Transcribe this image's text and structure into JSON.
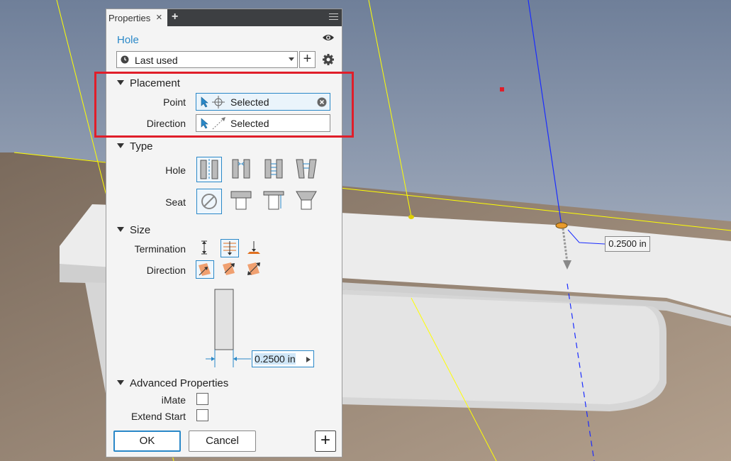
{
  "panel": {
    "tab_label": "Properties",
    "close_glyph": "×",
    "add_glyph": "+",
    "feature_title": "Hole",
    "preset_value": "Last used",
    "placement": {
      "heading": "Placement",
      "point_label": "Point",
      "point_value": "Selected",
      "direction_label": "Direction",
      "direction_value": "Selected"
    },
    "type": {
      "heading": "Type",
      "hole_label": "Hole",
      "seat_label": "Seat"
    },
    "size": {
      "heading": "Size",
      "termination_label": "Termination",
      "direction_label": "Direction",
      "diameter_value": "0.2500 in"
    },
    "advanced": {
      "heading": "Advanced Properties",
      "imate_label": "iMate",
      "extend_start_label": "Extend Start"
    },
    "ok_label": "OK",
    "cancel_label": "Cancel"
  },
  "viewport": {
    "callout_value": "0.2500 in"
  },
  "colors": {
    "accent": "#2a88c8",
    "highlight_box": "#e01e2a",
    "model_face": "#e2e2e2",
    "sketch_line": "#ffff00",
    "axis_line": "#1a2cff"
  },
  "icons": [
    "eye-icon",
    "clock-icon",
    "gear-icon",
    "cursor-icon",
    "point-icon",
    "direction-icon",
    "menu-icon"
  ]
}
